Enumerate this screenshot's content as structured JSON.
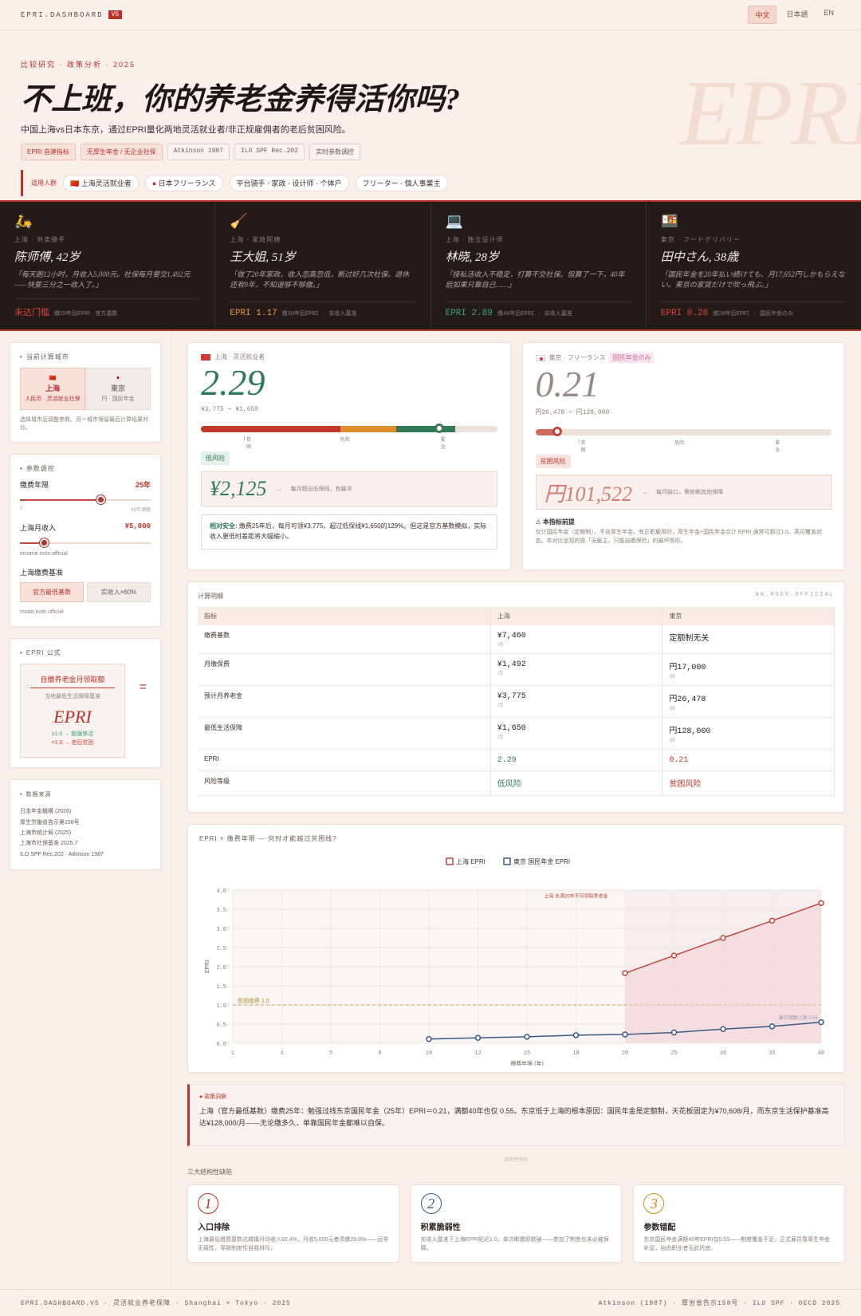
{
  "topbar": {
    "brand": "EPRI.DASHBOARD",
    "version": "V5",
    "langs": [
      "中文",
      "日本語",
      "EN"
    ]
  },
  "hero": {
    "kicker": "比较研究 · 政策分析 · 2025",
    "title": "不上班，你的养老金养得活你吗?",
    "subtitle": "中国上海vs日本东京，通过EPRI量化两地灵活就业者/非正规雇佣者的老后贫困风险。",
    "watermark": "EPRI",
    "tags": [
      "EPRI 自建指标",
      "无厚生年金 / 无企业社保",
      "Atkinson 1987",
      "ILO SPF Rec.202",
      "实时参数调控"
    ],
    "applies_label": "适用人群",
    "chips": [
      "上海灵活就业者",
      "日本フリーランス",
      "平台骑手 · 家政 · 设计师 · 个体户",
      "フリーター · 個人事業主"
    ]
  },
  "personas": [
    {
      "icon": "🛵",
      "meta": "上海 · 外卖骑手",
      "name": "陈师傅, 42岁",
      "quote": "「每天跑12小时，月收入5,000元。社保每月要交1,492元——快要三分之一收入了。」",
      "score": "未达门槛",
      "note": "缴15年后EPRI · 官方基数",
      "color": "red"
    },
    {
      "icon": "🧹",
      "meta": "上海 · 家政阿姨",
      "name": "王大姐, 51岁",
      "quote": "「做了20年家政，收入忽高忽低，断过好几次社保。退休还有9年，不知道够不够缴。」",
      "score": "EPRI 1.17",
      "note": "缴30年后EPRI · 实收入基准",
      "color": "orange"
    },
    {
      "icon": "💻",
      "meta": "上海 · 独立设计师",
      "name": "林晓, 28岁",
      "quote": "「接私活收入不稳定，打算不交社保。但算了一下，40年后如果只靠自己……」",
      "score": "EPRI 2.89",
      "note": "缴40年后EPRI · 实收入基准",
      "color": "green"
    },
    {
      "icon": "🍱",
      "meta": "東京 · フードデリバリー",
      "name": "田中さん, 38歳",
      "quote": "「国民年金を20年払い続けても、月17,652円しかもらえない。東京の家賃だけで吹っ飛ぶ。」",
      "score": "EPRI 0.28",
      "note": "缴20年后EPRI · 国民年金のみ",
      "color": "red"
    }
  ],
  "sidebar": {
    "city_title": "当前计算城市",
    "cities": [
      {
        "flag": "🇨🇳",
        "name": "上海",
        "sub": "人民币 · 灵活就业社保"
      },
      {
        "flag": "🇯🇵",
        "name": "東京",
        "sub": "円 · 国民年金"
      }
    ],
    "city_note": "选择城市后调整参数。另一城市保留最后计算结果对比。",
    "param_title": "参数调控",
    "years_label": "缴费年限",
    "years_value": "25年",
    "years_min": "1",
    "years_max": "40年满额",
    "years_fraction": 0.615,
    "income_label": "上海月收入",
    "income_value": "¥5,000",
    "income_note": "income.note.official",
    "income_fraction": 0.18,
    "base_label": "上海缴费基准",
    "base_opts": [
      "官方最低基数",
      "实收入×60%"
    ],
    "base_note": "mode.note.official",
    "formula_title": "EPRI 公式",
    "formula_num": "自缴养老金月领取额",
    "formula_den": "当地最低生活保障基准",
    "formula_big": "EPRI",
    "formula_rule1": "≥1.0 → 勉强够活",
    "formula_rule2": "<1.0 → 老后贫困",
    "src_title": "数据来源",
    "sources": [
      "日本年金機構 (2026)",
      "厚生労働省告示第158号",
      "上海市统计局 (2025)",
      "上海市社保基准 2025.7",
      "ILO SPF Rec.202 · Atkinson 1987"
    ]
  },
  "sh_card": {
    "header": "上海 · 灵活就业者",
    "epri": "2.29",
    "calc": "¥3,775 ÷ ¥1,650",
    "scale": [
      "贫困",
      "危险",
      "安全"
    ],
    "epri_value": 2.29,
    "risk": "低风险",
    "gap_amt": "¥2,125",
    "gap_text": "每月超出低保线，有缓冲",
    "explain_lead": "相对安全:",
    "explain": "缴费25年后，每月可领¥3,775，超过低保线¥1,650的129%。但这是官方基数模拟，实际收入更低时差距将大幅缩小。"
  },
  "tk_card": {
    "header": "東京 · フリーランス",
    "header_tag": "国民年金のみ",
    "epri": "0.21",
    "calc": "円26,478 ÷ 円128,000",
    "scale": [
      "贫困",
      "危险",
      "安全"
    ],
    "epri_value": 0.21,
    "risk": "贫困风险",
    "gap_amt": "円101,522",
    "gap_text": "每月缺口，需依赖其他保障",
    "warn_title": "⚠ 本指标前提",
    "warn": "仅计国民年金（定额制），不含厚生年金。有正职雇用时，厚生年金+国民年金合计 EPRI 通常可超过1.0。英可覆盖状态。本对比呈现的是「无雇主，只能自缴保险」的最坏情形。"
  },
  "table": {
    "title": "计算明细",
    "mode": "BK.MODE.OFFICIAL",
    "cols": [
      "指标",
      "上海",
      "東京"
    ],
    "rows": [
      {
        "label": "缴费基数",
        "sh": "¥7,460",
        "sh_u": "/月",
        "tk": "定额制无关",
        "tk_u": ""
      },
      {
        "label": "月缴保费",
        "sh": "¥1,492",
        "sh_u": "/月",
        "tk": "円17,000",
        "tk_u": "/月"
      },
      {
        "label": "预计月养老金",
        "sh": "¥3,775",
        "sh_u": "/月",
        "tk": "円26,478",
        "tk_u": "/月"
      },
      {
        "label": "最低生活保障",
        "sh": "¥1,650",
        "sh_u": "/月",
        "tk": "円128,000",
        "tk_u": "/月"
      },
      {
        "label": "EPRI",
        "sh": "2.29",
        "sh_u": "",
        "tk": "0.21",
        "tk_u": ""
      },
      {
        "label": "风险等级",
        "sh": "低风险",
        "sh_u": "",
        "tk": "贫困风险",
        "tk_u": ""
      }
    ]
  },
  "chart_title": "EPRI × 缴费年限 — 何时才能越过贫困线?",
  "chart_data": {
    "type": "line",
    "xlabel": "缴费年限 (年)",
    "ylabel": "EPRI",
    "ylim": [
      0,
      4
    ],
    "xticks": [
      1,
      5,
      10,
      15,
      20,
      25,
      30,
      35,
      40
    ],
    "xtick_labels": [
      "1",
      "3",
      "5",
      "8",
      "10",
      "12",
      "15",
      "18",
      "20",
      "25",
      "30",
      "35",
      "40"
    ],
    "yticks": [
      "0.0",
      "0.5",
      "1.0",
      "1.5",
      "2.0",
      "2.5",
      "3.0",
      "3.5",
      "4.0"
    ],
    "legend": [
      "上海 EPRI",
      "東京 国民年金 EPRI"
    ],
    "threshold_label": "贫困临界 1.0",
    "annotation_sh": "上海 未满20年不可领取养老金",
    "annotation_tk": "東京満額上限 0.55",
    "series": [
      {
        "name": "上海 EPRI",
        "x": [
          20,
          25,
          30,
          35,
          40
        ],
        "values": [
          1.83,
          2.29,
          2.75,
          3.2,
          3.66
        ],
        "color": "#c0473c"
      },
      {
        "name": "東京 国民年金 EPRI",
        "x": [
          10,
          12,
          15,
          18,
          20,
          25,
          30,
          35,
          40
        ],
        "values": [
          0.11,
          0.14,
          0.17,
          0.21,
          0.23,
          0.28,
          0.37,
          0.44,
          0.55
        ],
        "color": "#3b5a8a"
      }
    ]
  },
  "insight": {
    "label": "政策洞察",
    "text": "上海（官方最低基数）缴费25年：勉强过线东京国民年金（25年）EPRI＝0.21，满额40年也仅 0.55。东京低于上海的根本原因：国民年金是定额制，天花板固定为¥70,608/月，而东京生活保护基准高达¥128,000/月——无论缴多久，单靠国民年金都难以自保。"
  },
  "divider": "结构性分析",
  "structural": {
    "title": "三大结构性缺陷",
    "items": [
      {
        "n": "1",
        "h": "入口排除",
        "p": "上海最低缴费基数达城镇月均收入92.4%，月收5,000元者须缴29.8%——远非无痛性，导致制度性自我排斥。",
        "color": "#b8322a"
      },
      {
        "n": "2",
        "h": "积累脆弱性",
        "p": "实收入基准下上海EPRI贴近1.0，单次断缴即跌破——参加了制度也未必被保障。",
        "color": "#3b5a8a"
      },
      {
        "n": "3",
        "h": "参数错配",
        "p": "东京国民年金满额40年EPRI仅0.55——制度覆盖不足，正式雇员靠厚生年金补足，自由职业者无此托底。",
        "color": "#c4901e"
      }
    ]
  },
  "footer": {
    "left": "EPRI.DASHBOARD.V5 · 灵活就业养老保障 · Shanghai × Tokyo · 2025",
    "right": "Atkinson (1987) · 厚労省告示158号 · ILO SPF · OECD 2025"
  }
}
